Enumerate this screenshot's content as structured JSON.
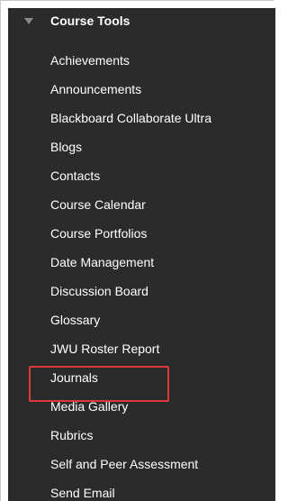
{
  "menu": {
    "title": "Course Tools",
    "items": [
      {
        "label": "Achievements"
      },
      {
        "label": "Announcements"
      },
      {
        "label": "Blackboard Collaborate Ultra"
      },
      {
        "label": "Blogs"
      },
      {
        "label": "Contacts"
      },
      {
        "label": "Course Calendar"
      },
      {
        "label": "Course Portfolios"
      },
      {
        "label": "Date Management"
      },
      {
        "label": "Discussion Board"
      },
      {
        "label": "Glossary"
      },
      {
        "label": "JWU Roster Report"
      },
      {
        "label": "Journals"
      },
      {
        "label": "Media Gallery"
      },
      {
        "label": "Rubrics"
      },
      {
        "label": "Self and Peer Assessment"
      },
      {
        "label": "Send Email"
      }
    ]
  },
  "icons": {
    "collapse": "chevron-down-icon"
  },
  "colors": {
    "panel_background": "#2b2b2b",
    "text": "#ffffff",
    "highlight_border": "#e0373b"
  },
  "highlighted_item": "Media Gallery"
}
